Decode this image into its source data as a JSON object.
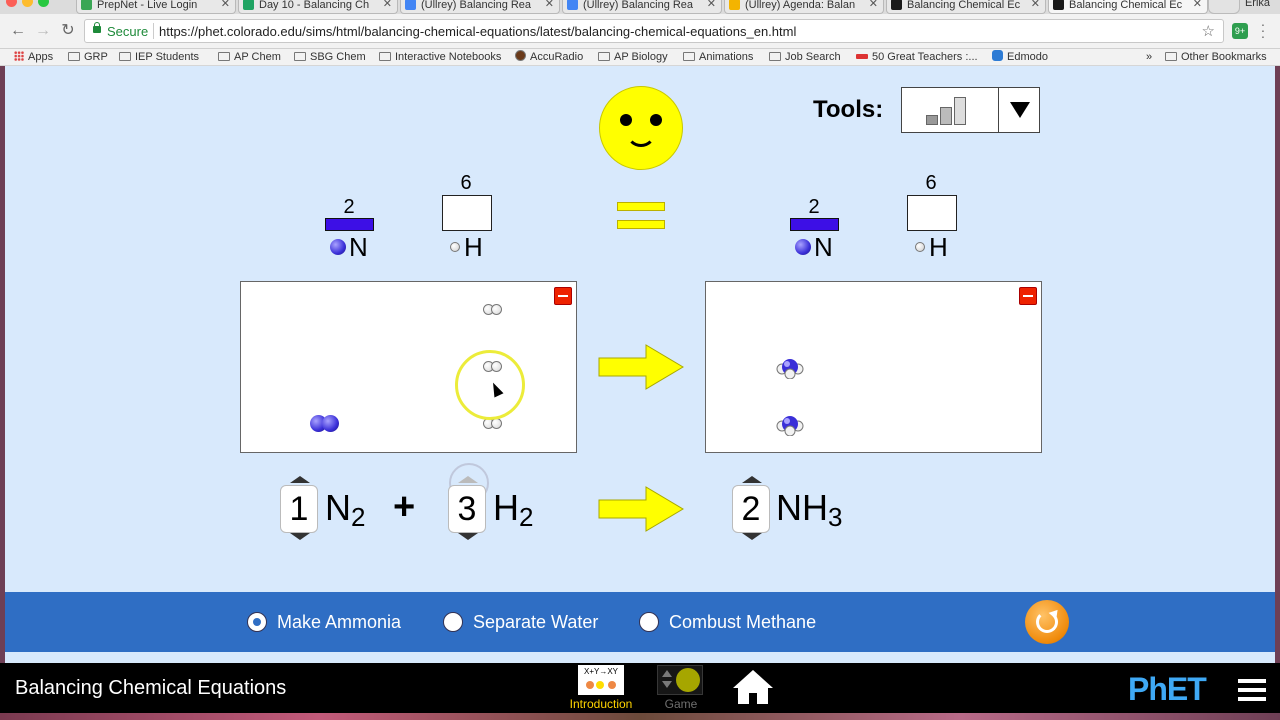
{
  "browser": {
    "tabs": [
      {
        "label": "PrepNet - Live Login",
        "favicon_color": "#3aa655"
      },
      {
        "label": "Day 10 - Balancing Ch",
        "favicon_color": "#1fa463"
      },
      {
        "label": "(Ullrey) Balancing Rea",
        "favicon_color": "#4285f4"
      },
      {
        "label": "(Ullrey) Balancing Rea",
        "favicon_color": "#4285f4"
      },
      {
        "label": "(Ullrey) Agenda: Balan",
        "favicon_color": "#f4b400"
      },
      {
        "label": "Balancing Chemical Ec",
        "favicon_color": "#1a1a1a"
      },
      {
        "label": "Balancing Chemical Ec",
        "favicon_color": "#1a1a1a",
        "active": true
      }
    ],
    "profile_name": "Erika",
    "secure_label": "Secure",
    "url": "https://phet.colorado.edu/sims/html/balancing-chemical-equations/latest/balancing-chemical-equations_en.html",
    "bookmarks": [
      "Apps",
      "GRP",
      "IEP Students",
      "AP Chem",
      "SBG Chem",
      "Interactive Notebooks",
      "AccuRadio",
      "AP Biology",
      "Animations",
      "Job Search",
      "50 Great Teachers :...",
      "Edmodo"
    ],
    "other_bookmarks": "Other Bookmarks",
    "overflow": "»"
  },
  "sim": {
    "tools_label": "Tools:",
    "balance_state": "balanced",
    "reactants_counts": {
      "N": "2",
      "H": "6",
      "N_fill": 1.0,
      "H_fill": 0.0
    },
    "products_counts": {
      "N": "2",
      "H": "6",
      "N_fill": 1.0,
      "H_fill": 0.0
    },
    "element_labels": {
      "N": "N",
      "H": "H"
    },
    "equation": {
      "c1": "1",
      "f1": "N",
      "s1": "2",
      "plus": "+",
      "c2": "3",
      "f2": "H",
      "s2": "2",
      "c3": "2",
      "f3": "NH",
      "s3": "3"
    }
  },
  "controls": {
    "options": [
      {
        "label": "Make Ammonia",
        "selected": true
      },
      {
        "label": "Separate Water",
        "selected": false
      },
      {
        "label": "Combust Methane",
        "selected": false
      }
    ]
  },
  "navbar": {
    "title": "Balancing Chemical Equations",
    "screens": [
      {
        "label": "Introduction",
        "active": true
      },
      {
        "label": "Game",
        "active": false
      }
    ],
    "brand": "PhET"
  },
  "colors": {
    "sim_bg": "#d8e9fc",
    "panel_blue": "#2f6ec4",
    "nitrogen": "#3d0fe6",
    "highlight_yellow": "#ffff00",
    "active_screen": "#ffd400"
  }
}
